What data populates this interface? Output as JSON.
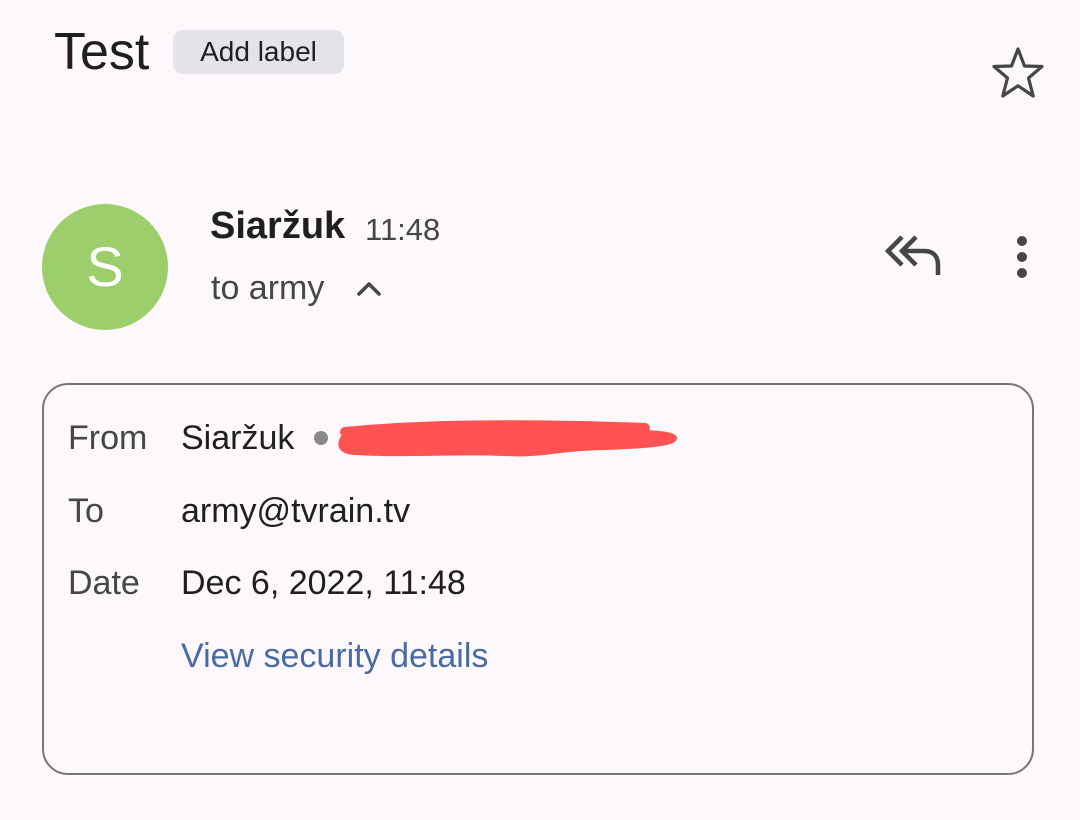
{
  "message": {
    "subject": "Test",
    "add_label": "Add label",
    "sender_name": "Siaržuk",
    "time": "11:48",
    "recipient_summary": "to army",
    "avatar_letter": "S"
  },
  "details": {
    "from_label": "From",
    "from_value": "Siaržuk",
    "to_label": "To",
    "to_value": "army@tvrain.tv",
    "date_label": "Date",
    "date_value": "Dec 6, 2022, 11:48",
    "security_link": "View security details"
  },
  "icons": {
    "star": "star-outline-icon",
    "reply_all": "reply-all-icon",
    "more": "more-vert-icon",
    "collapse": "chevron-up-icon"
  },
  "colors": {
    "background": "#fcf8fc",
    "avatar": "#9ccf6b",
    "chip": "#e4e3e8",
    "link": "#4a6aa5",
    "redaction": "#ff5252"
  }
}
